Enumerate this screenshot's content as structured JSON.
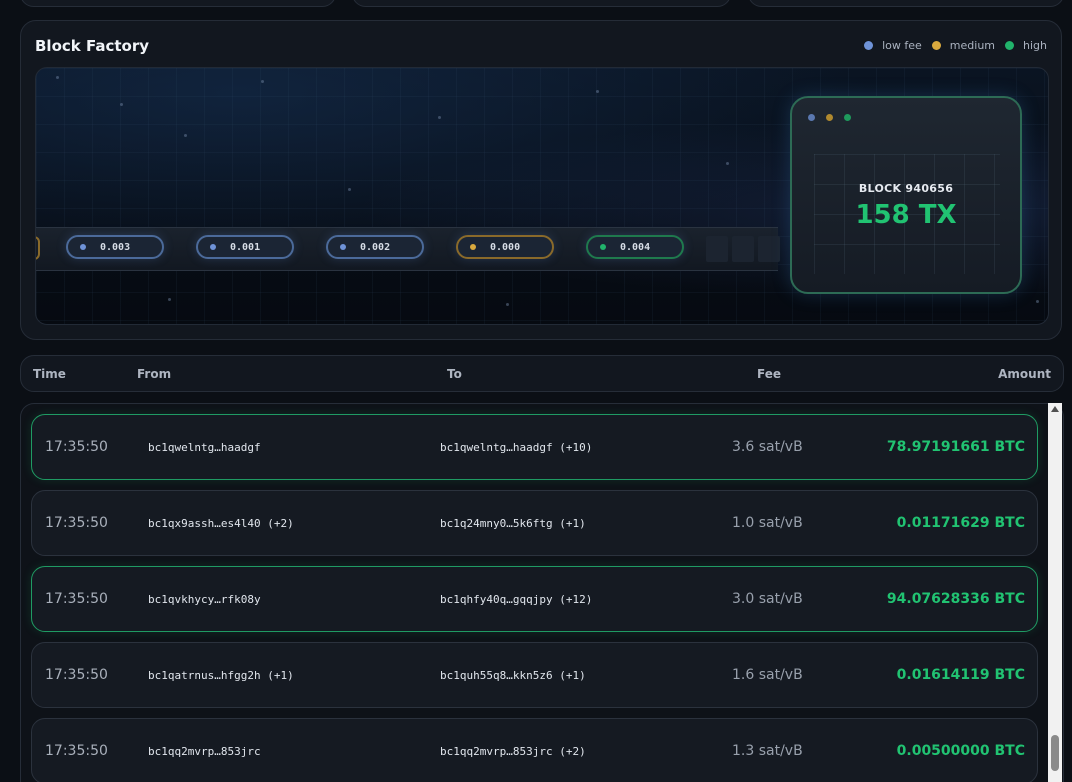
{
  "factory": {
    "title": "Block Factory",
    "legend": [
      {
        "label": "low fee",
        "color": "#6f93d8"
      },
      {
        "label": "medium",
        "color": "#d9a93e"
      },
      {
        "label": "high",
        "color": "#21b36b"
      }
    ],
    "pills": [
      {
        "value": "0.003",
        "color": "#6f93d8",
        "border": "#4b6a9a"
      },
      {
        "value": "0.001",
        "color": "#6f93d8",
        "border": "#4b6a9a"
      },
      {
        "value": "0.002",
        "color": "#6f93d8",
        "border": "#4b6a9a"
      },
      {
        "value": "0.000",
        "color": "#d9a93e",
        "border": "#8a6a2a"
      },
      {
        "value": "0.004",
        "color": "#21b36b",
        "border": "#1f7a4d"
      }
    ],
    "block": {
      "label": "BLOCK 940656",
      "count": "158 TX"
    }
  },
  "table": {
    "headers": {
      "time": "Time",
      "from": "From",
      "to": "To",
      "fee": "Fee",
      "amount": "Amount"
    },
    "rows": [
      {
        "time": "17:35:50",
        "from": "bc1qwelntg…haadgf",
        "to": "bc1qwelntg…haadgf (+10)",
        "fee": "3.6 sat/vB",
        "amount": "78.97191661 BTC",
        "highlight": true
      },
      {
        "time": "17:35:50",
        "from": "bc1qx9assh…es4l40 (+2)",
        "to": "bc1q24mny0…5k6ftg (+1)",
        "fee": "1.0 sat/vB",
        "amount": "0.01171629 BTC",
        "highlight": false
      },
      {
        "time": "17:35:50",
        "from": "bc1qvkhycy…rfk08y",
        "to": "bc1qhfy40q…gqqjpy (+12)",
        "fee": "3.0 sat/vB",
        "amount": "94.07628336 BTC",
        "highlight": true
      },
      {
        "time": "17:35:50",
        "from": "bc1qatrnus…hfgg2h (+1)",
        "to": "bc1quh55q8…kkn5z6 (+1)",
        "fee": "1.6 sat/vB",
        "amount": "0.01614119 BTC",
        "highlight": false
      },
      {
        "time": "17:35:50",
        "from": "bc1qq2mvrp…853jrc",
        "to": "bc1qq2mvrp…853jrc (+2)",
        "fee": "1.3 sat/vB",
        "amount": "0.00500000 BTC",
        "highlight": false
      }
    ]
  }
}
